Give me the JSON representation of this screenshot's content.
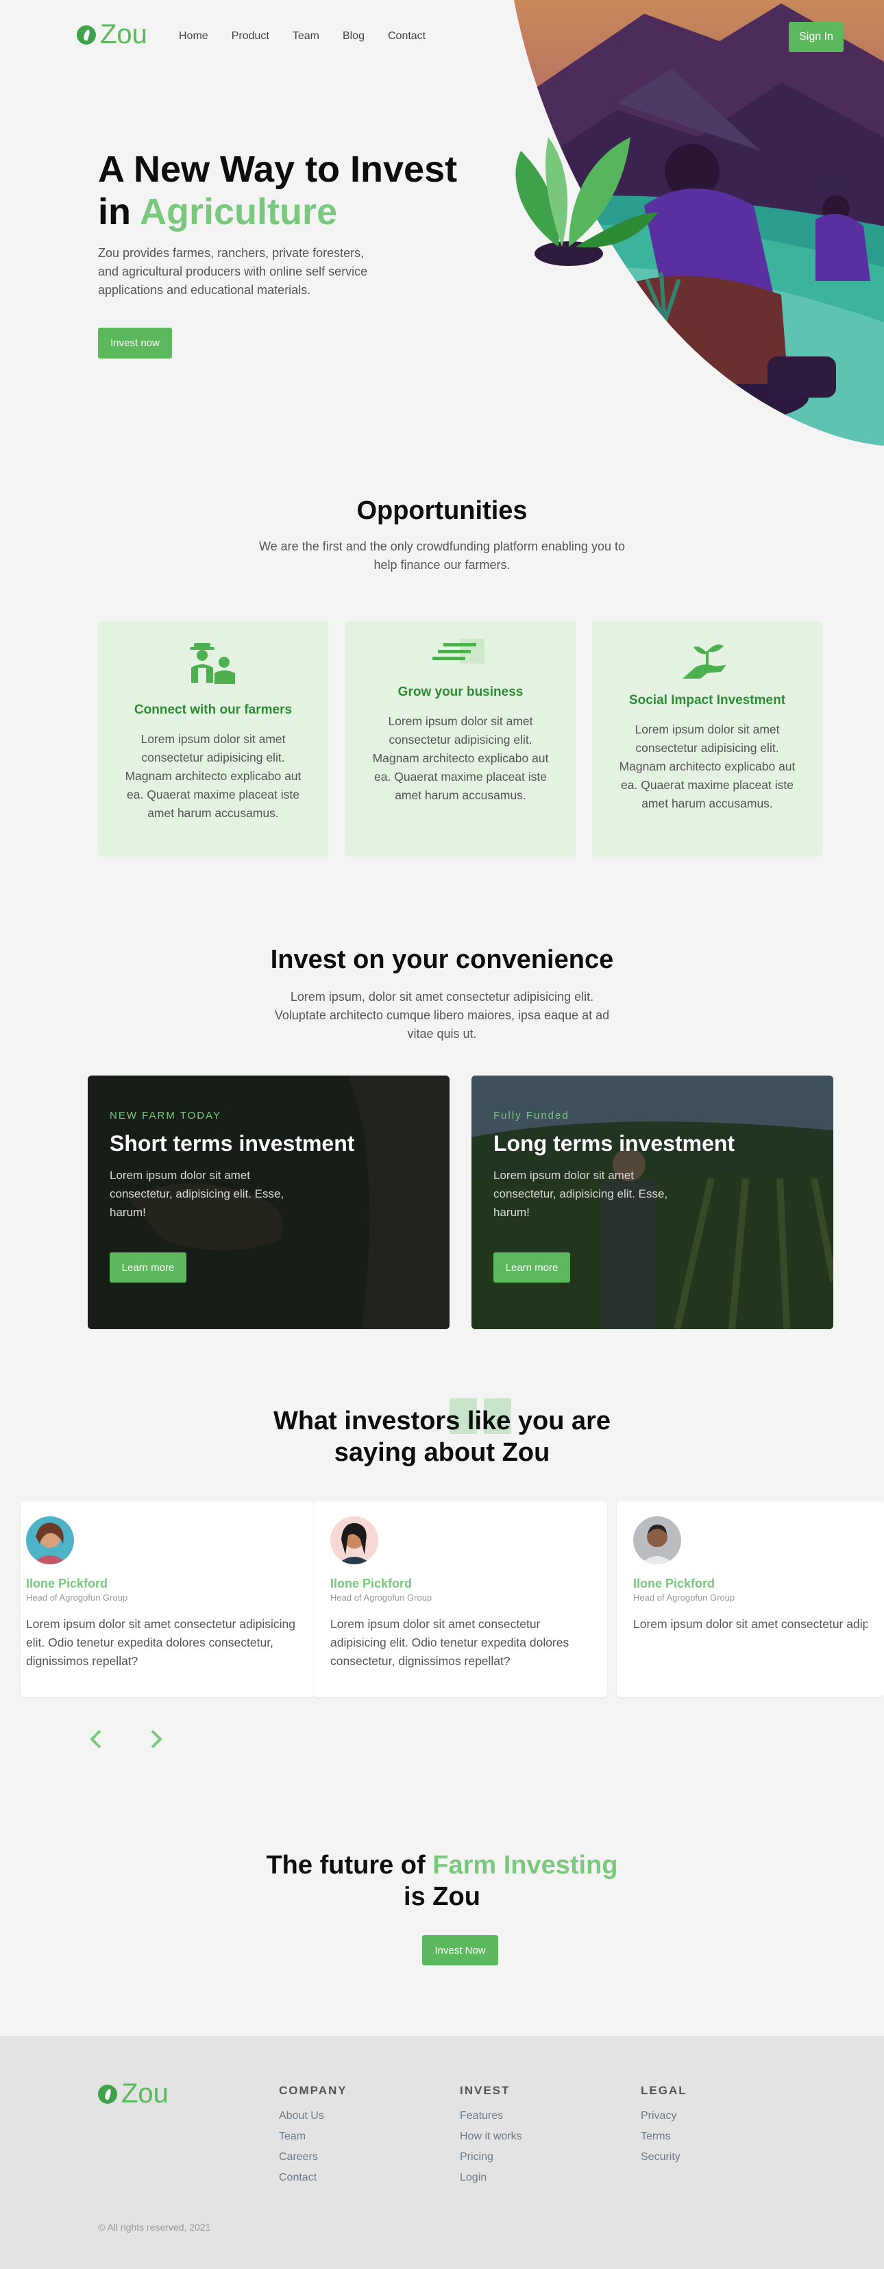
{
  "nav": {
    "brand": "Zou",
    "links": [
      "Home",
      "Product",
      "Team",
      "Blog",
      "Contact"
    ],
    "signin": "Sign In"
  },
  "hero": {
    "title_line1": "A New Way to Invest",
    "title_in": "in",
    "title_accent": "Agriculture",
    "description": "Zou provides farmes, ranchers, private foresters, and agricultural producers with online self service applications and educational materials.",
    "cta": "Invest now"
  },
  "opportunities": {
    "title": "Opportunities",
    "subtitle": "We are the first and the only crowdfunding platform enabling you to help finance our farmers.",
    "cards": [
      {
        "title": "Connect with our farmers",
        "text": "Lorem ipsum dolor sit amet consectetur adipisicing elit. Magnam architecto explicabo aut ea. Quaerat maxime placeat iste amet harum accusamus.",
        "icon": "farmers-icon"
      },
      {
        "title": "Grow your business",
        "text": "Lorem ipsum dolor sit amet consectetur adipisicing elit. Magnam architecto explicabo aut ea. Quaerat maxime placeat iste amet harum accusamus.",
        "icon": "growth-icon"
      },
      {
        "title": "Social Impact Investment",
        "text": "Lorem ipsum dolor sit amet consectetur adipisicing elit. Magnam architecto explicabo aut ea. Quaerat maxime placeat iste amet harum accusamus.",
        "icon": "plant-hand-icon"
      }
    ]
  },
  "convenience": {
    "title": "Invest on your convenience",
    "subtitle": "Lorem ipsum, dolor sit amet consectetur adipisicing elit. Voluptate architecto cumque libero maiores, ipsa eaque at ad vitae quis ut.",
    "cards": [
      {
        "kicker": "NEW FARM TODAY",
        "title": "Short terms investment",
        "text": "Lorem ipsum dolor sit amet consectetur, adipisicing elit. Esse, harum!",
        "cta": "Learn more"
      },
      {
        "kicker": "Fully Funded",
        "title": "Long terms investment",
        "text": "Lorem ipsum dolor sit amet consectetur, adipisicing elit. Esse, harum!",
        "cta": "Learn more"
      }
    ]
  },
  "testimonials": {
    "title_line1": "What investors like you are",
    "title_line2": "saying about Zou",
    "items": [
      {
        "name": "Ilone Pickford",
        "role": "Head of Agrogofun Group",
        "quote": "Lorem ipsum dolor sit amet consectetur adipisicing elit. Odio tenetur expedita dolores consectetur, dignissimos repellat?"
      },
      {
        "name": "Ilone Pickford",
        "role": "Head of Agrogofun Group",
        "quote": "Lorem ipsum dolor sit amet consectetur adipisicing elit. Odio tenetur expedita dolores consectetur, dignissimos repellat?"
      },
      {
        "name": "Ilone Pickford",
        "role": "Head of Agrogofun Group",
        "quote": "Lorem ipsum dolor sit amet consectetur adipisicing elit. Odio tenetur expedita dolores consectetur, dignissimos repellat?"
      }
    ]
  },
  "future": {
    "title_pre": "The future of",
    "title_accent": "Farm Investing",
    "title_line2": "is Zou",
    "cta": "Invest Now"
  },
  "footer": {
    "brand": "Zou",
    "columns": [
      {
        "heading": "COMPANY",
        "links": [
          "About Us",
          "Team",
          "Careers",
          "Contact"
        ]
      },
      {
        "heading": "INVEST",
        "links": [
          "Features",
          "How it works",
          "Pricing",
          "Login"
        ]
      },
      {
        "heading": "LEGAL",
        "links": [
          "Privacy",
          "Terms",
          "Security"
        ]
      }
    ],
    "copyright": "© All rights reserved, 2021"
  },
  "colors": {
    "accent": "#5cb85c",
    "accent_light": "#7ac77e",
    "card_bg": "#e3f2e1",
    "footer_bg": "#e3e3e3"
  }
}
